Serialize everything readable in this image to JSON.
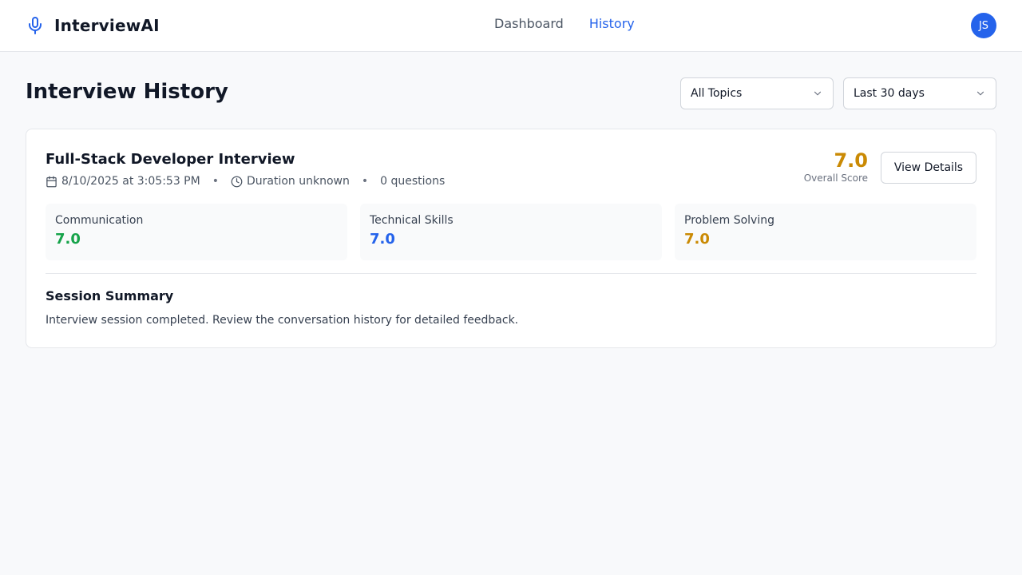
{
  "header": {
    "brand": "InterviewAI",
    "nav": [
      {
        "label": "Dashboard",
        "active": false
      },
      {
        "label": "History",
        "active": true
      }
    ],
    "avatar_initials": "JS",
    "accent_color": "#2563eb"
  },
  "page": {
    "title": "Interview History",
    "filters": {
      "topic": "All Topics",
      "range": "Last 30 days"
    }
  },
  "session": {
    "title": "Full-Stack Developer Interview",
    "date": "8/10/2025 at 3:05:53 PM",
    "duration": "Duration unknown",
    "questions": "0 questions",
    "overall_score": "7.0",
    "overall_label": "Overall Score",
    "view_button": "View Details",
    "metrics": [
      {
        "label": "Communication",
        "value": "7.0",
        "color": "#16a34a"
      },
      {
        "label": "Technical Skills",
        "value": "7.0",
        "color": "#2563eb"
      },
      {
        "label": "Problem Solving",
        "value": "7.0",
        "color": "#ca8a04"
      }
    ],
    "summary_title": "Session Summary",
    "summary_text": "Interview session completed. Review the conversation history for detailed feedback."
  },
  "icons": {
    "brand": "microphone-icon",
    "date": "calendar-icon",
    "duration": "clock-icon",
    "select": "chevron-down-icon"
  }
}
